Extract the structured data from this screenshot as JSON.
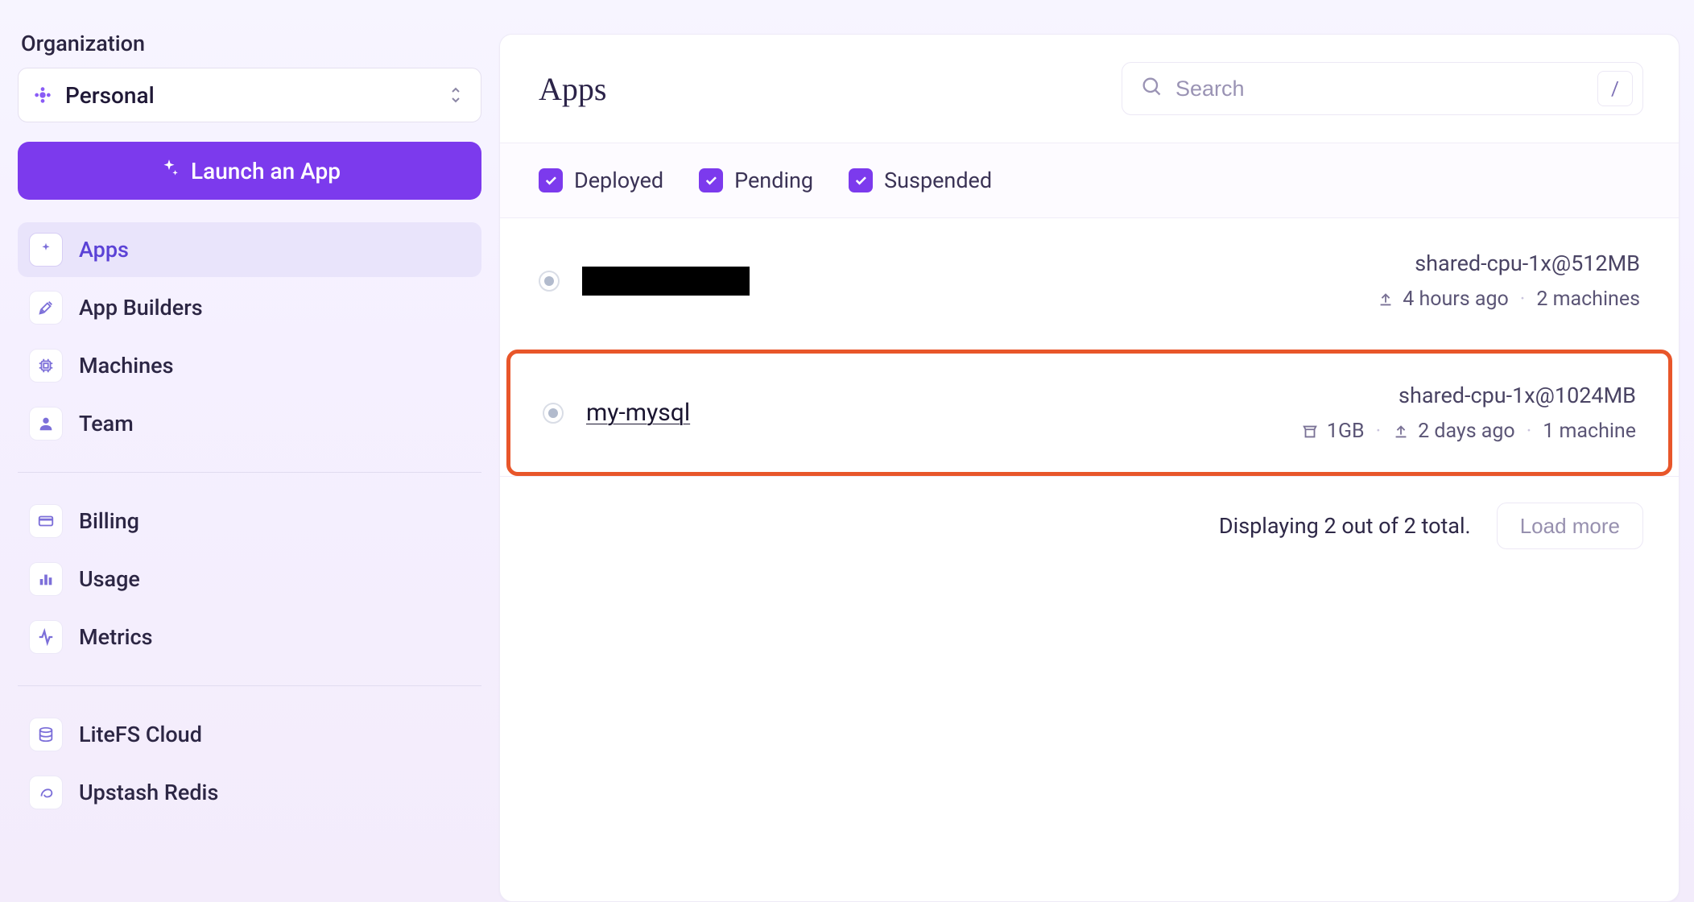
{
  "sidebar": {
    "org_label": "Organization",
    "org_name": "Personal",
    "launch_label": "Launch an App",
    "nav": {
      "apps": "Apps",
      "app_builders": "App Builders",
      "machines": "Machines",
      "team": "Team",
      "billing": "Billing",
      "usage": "Usage",
      "metrics": "Metrics",
      "litefs": "LiteFS Cloud",
      "upstash": "Upstash Redis"
    }
  },
  "main": {
    "title": "Apps",
    "search_placeholder": "Search",
    "kbd_hint": "/",
    "filters": {
      "deployed": "Deployed",
      "pending": "Pending",
      "suspended": "Suspended"
    },
    "apps": [
      {
        "name_redacted": true,
        "cpu": "shared-cpu-1x@512MB",
        "age": "4 hours ago",
        "machines": "2 machines"
      },
      {
        "name": "my-mysql",
        "cpu": "shared-cpu-1x@1024MB",
        "storage": "1GB",
        "age": "2 days ago",
        "machines": "1 machine",
        "highlighted": true
      }
    ],
    "total_text": "Displaying 2 out of 2 total.",
    "load_more": "Load more"
  }
}
